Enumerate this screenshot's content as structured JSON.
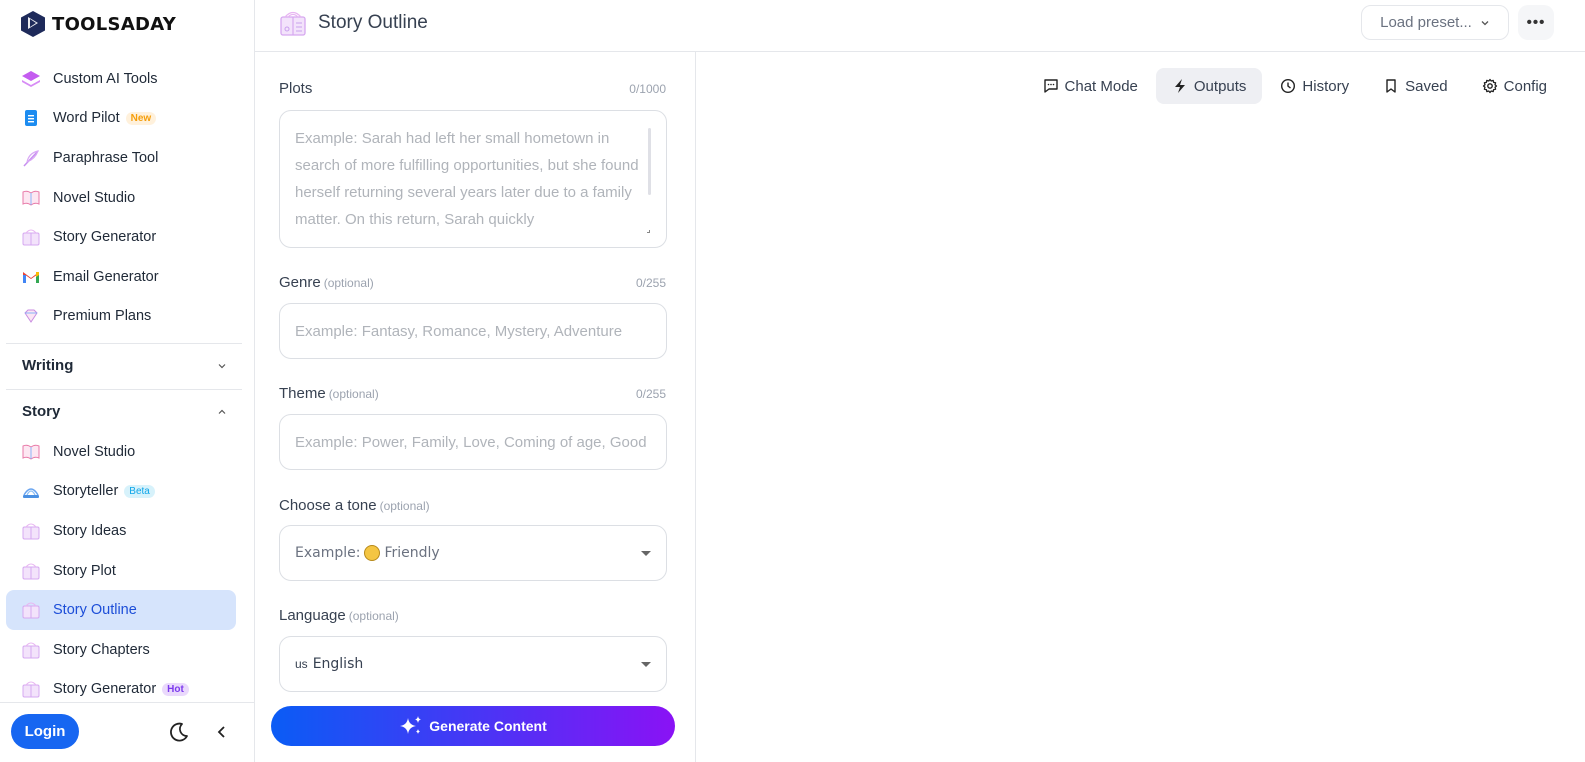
{
  "app": {
    "brand": "TOOLSADAY"
  },
  "sidebar": {
    "top_items": [
      {
        "label": "Custom AI Tools",
        "icon": "layers-icon"
      },
      {
        "label": "Word Pilot",
        "icon": "document-icon",
        "badge": "New"
      },
      {
        "label": "Paraphrase Tool",
        "icon": "feather-icon"
      },
      {
        "label": "Novel Studio",
        "icon": "book-icon"
      },
      {
        "label": "Story Generator",
        "icon": "storybook-icon"
      },
      {
        "label": "Email Generator",
        "icon": "gmail-icon"
      },
      {
        "label": "Premium Plans",
        "icon": "diamond-icon"
      }
    ],
    "sections": [
      {
        "title": "Writing",
        "expanded": false
      },
      {
        "title": "Story",
        "expanded": true
      }
    ],
    "story_items": [
      {
        "label": "Novel Studio",
        "icon": "book-icon"
      },
      {
        "label": "Storyteller",
        "icon": "storyteller-icon",
        "badge": "Beta"
      },
      {
        "label": "Story Ideas",
        "icon": "storybook-icon"
      },
      {
        "label": "Story Plot",
        "icon": "storybook-icon"
      },
      {
        "label": "Story Outline",
        "icon": "storybook-icon",
        "active": true
      },
      {
        "label": "Story Chapters",
        "icon": "storybook-icon"
      },
      {
        "label": "Story Generator",
        "icon": "storybook-icon",
        "badge": "Hot"
      }
    ],
    "footer": {
      "login_label": "Login"
    }
  },
  "header": {
    "title": "Story Outline",
    "preset_label": "Load preset...",
    "more_label": "•••"
  },
  "form": {
    "plots": {
      "label": "Plots",
      "counter": "0/1000",
      "placeholder": "Example: Sarah had left her small hometown in search of more fulfilling opportunities, but she found herself returning several years later due to a family matter. On this return, Sarah quickly"
    },
    "genre": {
      "label": "Genre",
      "optional": "(optional)",
      "counter": "0/255",
      "placeholder": "Example: Fantasy, Romance, Mystery, Adventure"
    },
    "theme": {
      "label": "Theme",
      "optional": "(optional)",
      "counter": "0/255",
      "placeholder": "Example: Power, Family, Love, Coming of age, Good"
    },
    "tone": {
      "label": "Choose a tone",
      "optional": "(optional)",
      "prefix": "Example:",
      "value": "Friendly"
    },
    "language": {
      "label": "Language",
      "optional": "(optional)",
      "flag": "us",
      "value": "English"
    },
    "generate_label": "Generate Content"
  },
  "output": {
    "tabs": [
      {
        "label": "Chat Mode",
        "icon": "chat-icon"
      },
      {
        "label": "Outputs",
        "icon": "lightning-icon",
        "active": true
      },
      {
        "label": "History",
        "icon": "clock-icon"
      },
      {
        "label": "Saved",
        "icon": "bookmark-icon"
      },
      {
        "label": "Config",
        "icon": "gear-icon"
      }
    ]
  },
  "colors": {
    "accent": "#1766f1",
    "active_bg": "#d6e4fc",
    "gradient_start": "#0a5cf5",
    "gradient_end": "#8a12f5"
  }
}
